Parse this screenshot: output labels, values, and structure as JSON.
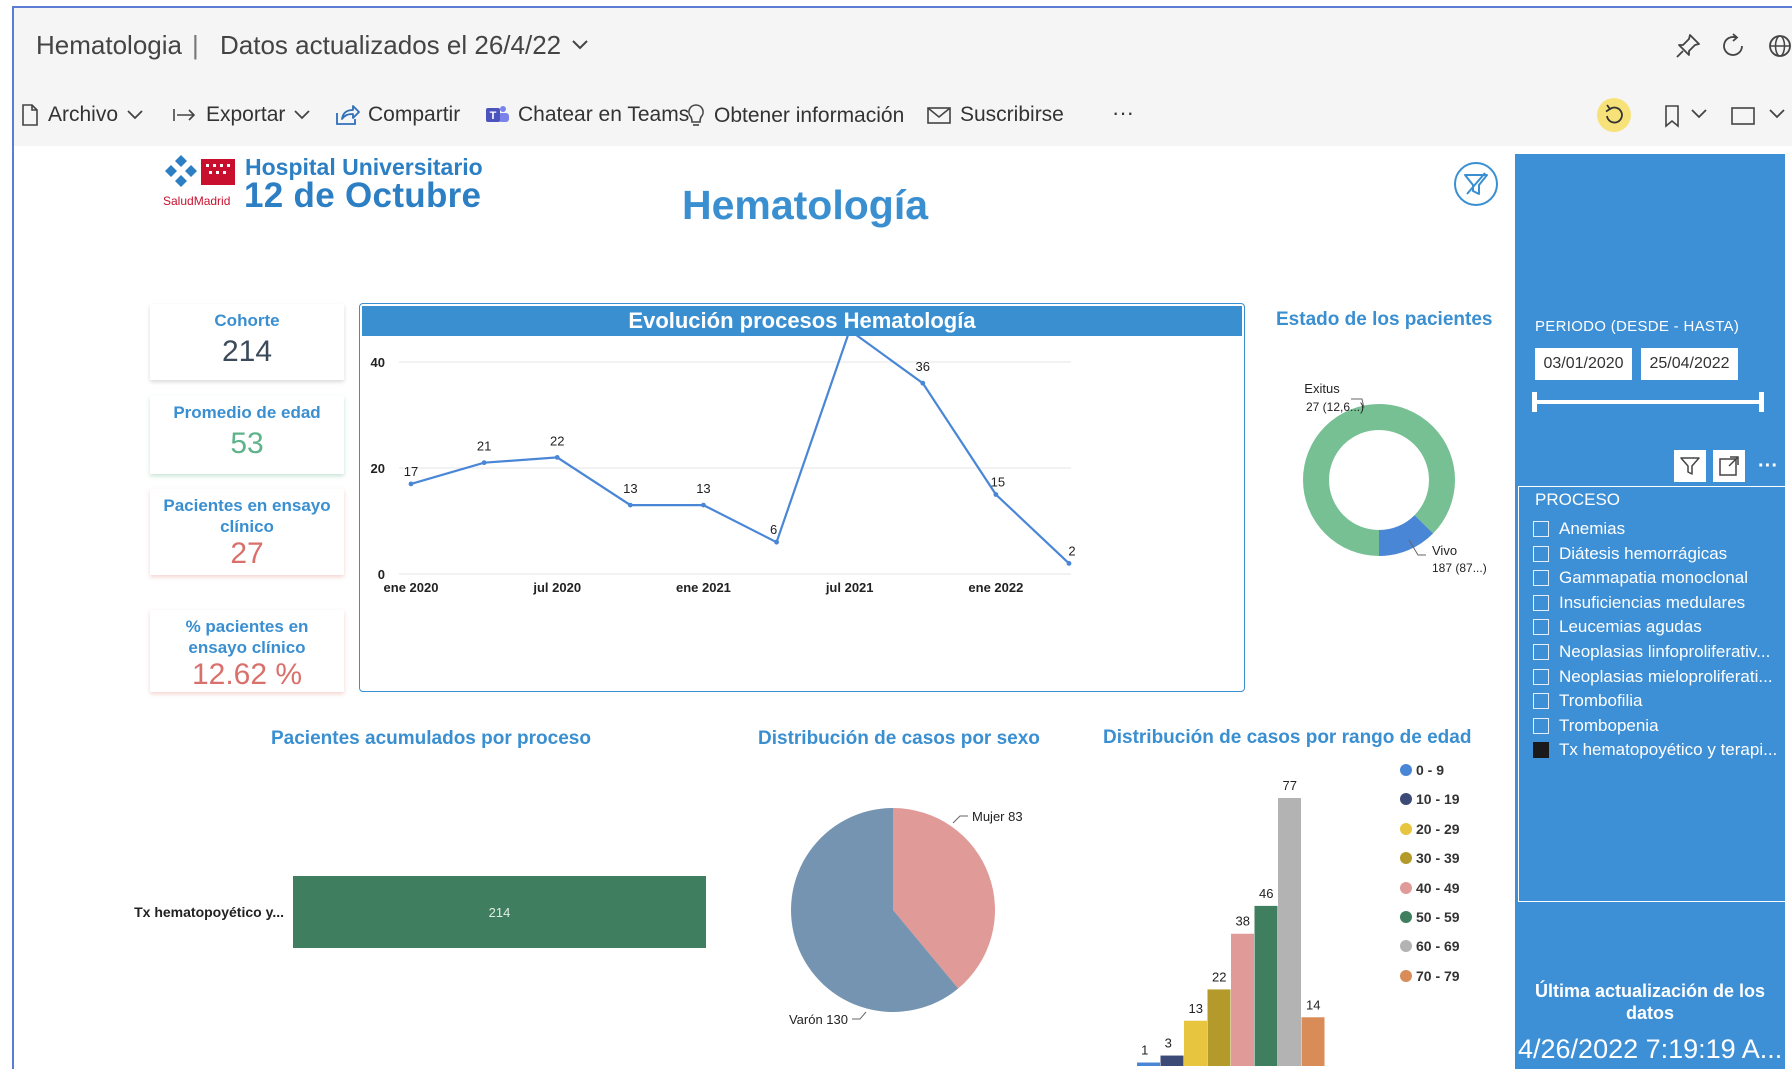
{
  "titlebar": {
    "app": "Hematologia",
    "separator": "|",
    "updated": "Datos actualizados el 26/4/22"
  },
  "toolbar": {
    "archivo": "Archivo",
    "exportar": "Exportar",
    "compartir": "Compartir",
    "chatear": "Chatear en Teams",
    "obtener": "Obtener información",
    "suscribirse": "Suscribirse",
    "more": "···"
  },
  "logo": {
    "line1": "Hospital Universitario",
    "line2": "12 de Octubre",
    "brand": "SaludMadrid"
  },
  "page_title": "Hematología",
  "kpis": [
    {
      "label": "Cohorte",
      "value": "214",
      "color": "#3b4a5a"
    },
    {
      "label": "Promedio de edad",
      "value": "53",
      "color": "#5fb38a"
    },
    {
      "label": "Pacientes en ensayo clínico",
      "value": "27",
      "color": "#d9706b"
    },
    {
      "label": "% pacientes en ensayo clínico",
      "value": "12.62 %",
      "color": "#d9706b"
    }
  ],
  "chart_data": [
    {
      "type": "line",
      "title": "Evolución procesos Hematología",
      "x": [
        "2020-01",
        "2020-04",
        "2020-07",
        "2020-10",
        "2021-01",
        "2021-04",
        "2021-07",
        "2021-10",
        "2022-01",
        "2022-04"
      ],
      "values": [
        17,
        21,
        22,
        13,
        13,
        6,
        46,
        36,
        15,
        2
      ],
      "x_ticks": [
        "ene 2020",
        "jul 2020",
        "ene 2021",
        "jul 2021",
        "ene 2022"
      ],
      "y_ticks": [
        0,
        20,
        40
      ],
      "ylim": [
        0,
        50
      ],
      "color": "#4a86d6",
      "grid": true
    },
    {
      "type": "pie",
      "title": "Estado de los pacientes",
      "donut": true,
      "categories": [
        "Exitus",
        "Vivo"
      ],
      "values": [
        27,
        187
      ],
      "labels": [
        "27 (12,6...)",
        "187 (87...)"
      ],
      "colors": [
        "#4a86d6",
        "#76c094"
      ]
    },
    {
      "type": "bar",
      "title": "Pacientes acumulados por proceso",
      "orientation": "horizontal",
      "categories": [
        "Tx hematopoyético y..."
      ],
      "values": [
        214
      ],
      "color": "#3f7f5f"
    },
    {
      "type": "pie",
      "title": "Distribución de casos por sexo",
      "categories": [
        "Mujer",
        "Varón"
      ],
      "values": [
        83,
        130
      ],
      "colors": [
        "#e09a97",
        "#7494b1"
      ]
    },
    {
      "type": "bar",
      "title": "Distribución de casos por rango de edad",
      "categories": [
        "0 - 9",
        "10 - 19",
        "20 - 29",
        "30 - 39",
        "40 - 49",
        "50 - 59",
        "60 - 69",
        "70 - 79"
      ],
      "values": [
        1,
        3,
        13,
        22,
        38,
        46,
        77,
        14
      ],
      "colors": [
        "#4a86d6",
        "#3c4a78",
        "#e8c53e",
        "#b39a2a",
        "#e09a97",
        "#3f7f5f",
        "#b3b3b3",
        "#d98c58"
      ],
      "legend": "right"
    }
  ],
  "panel": {
    "periodo_label": "PERIODO (DESDE - HASTA)",
    "date_from": "03/01/2020",
    "date_to": "25/04/2022",
    "proceso_label": "PROCESO",
    "procesos": [
      {
        "label": "Anemias",
        "checked": false
      },
      {
        "label": "Diátesis hemorrágicas",
        "checked": false
      },
      {
        "label": "Gammapatia monoclonal",
        "checked": false
      },
      {
        "label": "Insuficiencias medulares",
        "checked": false
      },
      {
        "label": "Leucemias agudas",
        "checked": false
      },
      {
        "label": "Neoplasias linfoproliferativ...",
        "checked": false
      },
      {
        "label": "Neoplasias mieloproliferati...",
        "checked": false
      },
      {
        "label": "Trombofilia",
        "checked": false
      },
      {
        "label": "Trombopenia",
        "checked": false
      },
      {
        "label": "Tx hematopoyético y terapi...",
        "checked": true
      }
    ],
    "last_update_label": "Última actualización de los datos",
    "last_update_value": "4/26/2022 7:19:19 A..."
  },
  "colors": {
    "accent": "#3a8fd1",
    "panel": "#3d8fd6"
  }
}
